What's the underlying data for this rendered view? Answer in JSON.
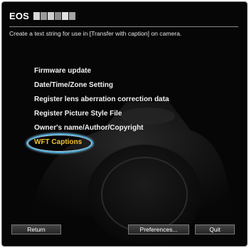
{
  "app": {
    "title": "EOS",
    "subtitle": "Create a text string for use in [Transfer with caption] on camera."
  },
  "menu": {
    "items": [
      {
        "label": "Firmware update"
      },
      {
        "label": "Date/Time/Zone Setting"
      },
      {
        "label": "Register lens aberration correction data"
      },
      {
        "label": "Register Picture Style File"
      },
      {
        "label": "Owner's name/Author/Copyright"
      },
      {
        "label": "WFT Captions"
      }
    ],
    "selected_label": "WFT Captions"
  },
  "buttons": {
    "return_label": "Return",
    "preferences_label": "Preferences...",
    "quit_label": "Quit"
  },
  "colors": {
    "background": "#060606",
    "text": "#f2f2f2",
    "selected": "#f0c230",
    "highlight_oval": "#4aa8d8"
  }
}
